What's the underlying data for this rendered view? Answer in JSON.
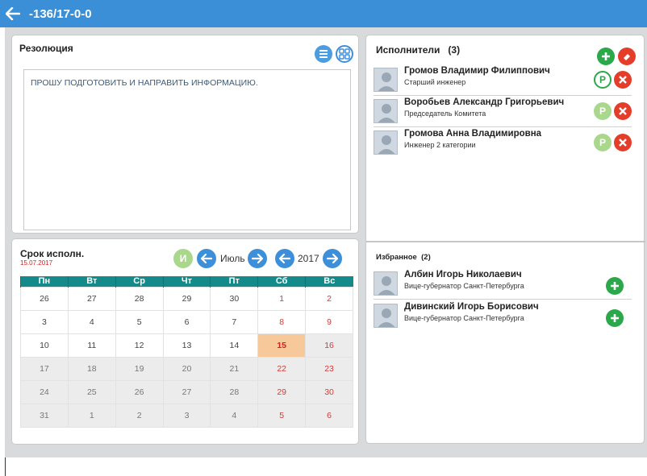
{
  "header": {
    "title": "-136/17-0-0"
  },
  "resolution": {
    "title": "Резолюция",
    "text": "ПРОШУ ПОДГОТОВИТЬ И НАПРАВИТЬ  ИНФОРМАЦИЮ."
  },
  "calendar": {
    "title": "Срок исполн.",
    "selected_date": "15.07.2017",
    "today_button": "И",
    "month": "Июль",
    "year": "2017",
    "weekdays": [
      "Пн",
      "Вт",
      "Ср",
      "Чт",
      "Пт",
      "Сб",
      "Вс"
    ],
    "rows": [
      [
        "26",
        "27",
        "28",
        "29",
        "30",
        "1",
        "2"
      ],
      [
        "3",
        "4",
        "5",
        "6",
        "7",
        "8",
        "9"
      ],
      [
        "10",
        "11",
        "12",
        "13",
        "14",
        "15",
        "16"
      ],
      [
        "17",
        "18",
        "19",
        "20",
        "21",
        "22",
        "23"
      ],
      [
        "24",
        "25",
        "26",
        "27",
        "28",
        "29",
        "30"
      ],
      [
        "31",
        "1",
        "2",
        "3",
        "4",
        "5",
        "6"
      ]
    ],
    "selected_day": "15"
  },
  "executors": {
    "title": "Исполнители",
    "count": "(3)",
    "items": [
      {
        "name": "Громов Владимир Филиппович",
        "role": "Старший инженер"
      },
      {
        "name": "Воробьев Александр  Григорьевич",
        "role": "Председатель Комитета"
      },
      {
        "name": "Громова Анна Владимировна",
        "role": "Инженер 2 категории"
      }
    ]
  },
  "favorites": {
    "title": "Избранное",
    "count": "(2)",
    "items": [
      {
        "name": "Албин Игорь Николаевич",
        "role": "Вице-губернатор Санкт-Петербурга"
      },
      {
        "name": "Дивинский Игорь Борисович",
        "role": "Вице-губернатор Санкт-Петербурга"
      }
    ]
  },
  "icons": {
    "back": "arrow-left-icon",
    "add": "plus-icon",
    "remove": "close-icon",
    "clear": "eraser-icon",
    "primary": "p-icon"
  },
  "colors": {
    "topbar": "#3a8fd6",
    "calendar_header": "#148a8a",
    "selected_day": "#f7c89a",
    "weekend_text": "#d23b3b"
  }
}
